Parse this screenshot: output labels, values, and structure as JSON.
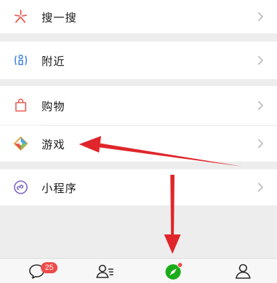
{
  "menu": {
    "search_label": "搜一搜",
    "nearby_label": "附近",
    "shopping_label": "购物",
    "games_label": "游戏",
    "miniprogram_label": "小程序"
  },
  "tabbar": {
    "chats_badge": "25"
  },
  "colors": {
    "annotation_arrow": "#e0262a",
    "discover_icon": "#1aad19",
    "badge": "#f04b4b"
  },
  "icons": {
    "search": "search-spark-icon",
    "nearby": "nearby-person-icon",
    "shopping": "shopping-bag-icon",
    "games": "game-diamond-icon",
    "miniprogram": "miniprogram-icon",
    "chats": "chat-bubble-icon",
    "contacts": "contacts-icon",
    "discover": "compass-icon",
    "me": "person-icon"
  }
}
